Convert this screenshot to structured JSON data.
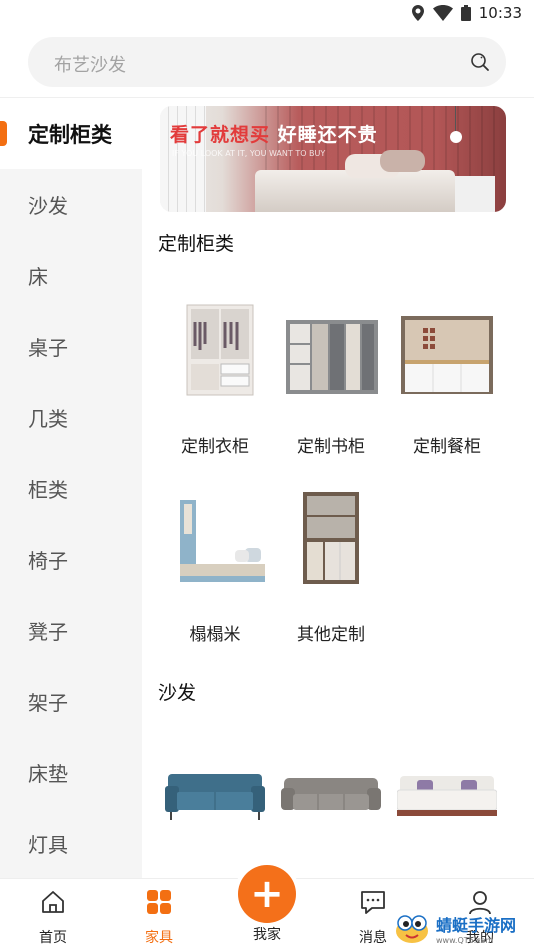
{
  "status": {
    "time": "10:33",
    "icons": [
      "location-icon",
      "wifi-icon",
      "battery-icon"
    ]
  },
  "search": {
    "placeholder": "布艺沙发",
    "icon": "search-icon"
  },
  "sidebar": {
    "items": [
      {
        "label": "定制柜类",
        "active": true
      },
      {
        "label": "沙发"
      },
      {
        "label": "床"
      },
      {
        "label": "桌子"
      },
      {
        "label": "几类"
      },
      {
        "label": "柜类"
      },
      {
        "label": "椅子"
      },
      {
        "label": "凳子"
      },
      {
        "label": "架子"
      },
      {
        "label": "床垫"
      },
      {
        "label": "灯具"
      }
    ]
  },
  "banner": {
    "title_part1": "看了就想买",
    "title_part2": "好睡还不贵",
    "subtitle": "IF YOU LOOK AT IT, YOU WANT TO BUY"
  },
  "sections": [
    {
      "title": "定制柜类",
      "items": [
        {
          "label": "定制衣柜",
          "icon": "wardrobe-image"
        },
        {
          "label": "定制书柜",
          "icon": "bookcase-image"
        },
        {
          "label": "定制餐柜",
          "icon": "sideboard-image"
        },
        {
          "label": "榻榻米",
          "icon": "tatami-image"
        },
        {
          "label": "其他定制",
          "icon": "custom-cabinet-image"
        }
      ]
    },
    {
      "title": "沙发",
      "items": [
        {
          "icon": "blue-sofa-image"
        },
        {
          "icon": "gray-sofa-image"
        },
        {
          "icon": "white-sofa-image"
        }
      ]
    }
  ],
  "tabbar": {
    "tabs": [
      {
        "label": "首页",
        "icon": "home-icon"
      },
      {
        "label": "家具",
        "icon": "grid-icon",
        "active": true
      },
      {
        "label": "我家",
        "icon": "plus-icon"
      },
      {
        "label": "消息",
        "icon": "message-icon"
      },
      {
        "label": "我的",
        "icon": "user-icon"
      }
    ]
  },
  "watermark": {
    "name": "蜻蜓手游网",
    "url": "www.QT6.com"
  },
  "colors": {
    "accent": "#f36f12",
    "sidebar_bg": "#f5f5f5"
  }
}
